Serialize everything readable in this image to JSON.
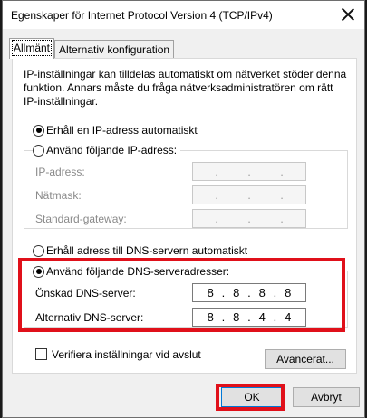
{
  "window": {
    "title": "Egenskaper för Internet Protocol Version 4 (TCP/IPv4)"
  },
  "tabs": [
    {
      "label": "Allmänt",
      "active": true
    },
    {
      "label": "Alternativ konfiguration",
      "active": false
    }
  ],
  "description": "IP-inställningar kan tilldelas automatiskt om nätverket stöder denna funktion. Annars måste du fråga nätverksadministratören om rätt IP-inställningar.",
  "ip": {
    "auto_label": "Erhåll en IP-adress automatiskt",
    "auto_selected": true,
    "manual_label": "Använd följande IP-adress:",
    "fields": [
      {
        "label": "IP-adress:",
        "value": [
          ".",
          ".",
          "."
        ]
      },
      {
        "label": "Nätmask:",
        "value": [
          ".",
          ".",
          "."
        ]
      },
      {
        "label": "Standard-gateway:",
        "value": [
          ".",
          ".",
          "."
        ]
      }
    ]
  },
  "dns": {
    "auto_label": "Erhåll adress till DNS-servern automatiskt",
    "manual_label": "Använd följande DNS-serveradresser:",
    "manual_selected": true,
    "preferred_label": "Önskad DNS-server:",
    "preferred_octets": [
      "8",
      "8",
      "8",
      "8"
    ],
    "alternate_label": "Alternativ DNS-server:",
    "alternate_octets": [
      "8",
      "8",
      "4",
      "4"
    ]
  },
  "validate_label": "Verifiera inställningar vid avslut",
  "validate_checked": false,
  "buttons": {
    "advanced": "Avancerat...",
    "ok": "OK",
    "cancel": "Avbryt"
  },
  "highlight_color": "#e0101a"
}
